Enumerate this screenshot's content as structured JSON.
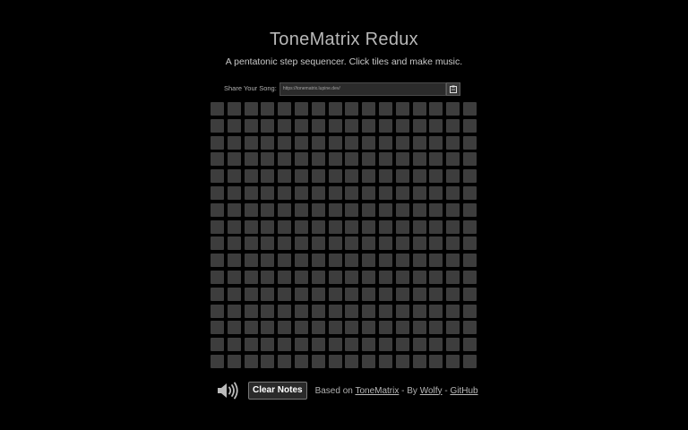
{
  "header": {
    "title": "ToneMatrix Redux",
    "subtitle": "A pentatonic step sequencer. Click tiles and make music."
  },
  "share": {
    "label": "Share Your Song:",
    "url": "https://tonematrix.lupine.dev/",
    "copy_icon": "clipboard-icon"
  },
  "grid": {
    "rows": 16,
    "columns": 16,
    "active_tiles": []
  },
  "footer": {
    "speaker_icon": "speaker-icon",
    "clear_label": "Clear Notes",
    "based_on_prefix": "Based on",
    "tonematrix_link": "ToneMatrix",
    "by_separator": "- By",
    "author_link": "Wolfy",
    "dash": "-",
    "github_link": "GitHub"
  },
  "colors": {
    "background": "#000000",
    "tile": "#3d3d3d",
    "tile_active": "#e0e0e0"
  }
}
